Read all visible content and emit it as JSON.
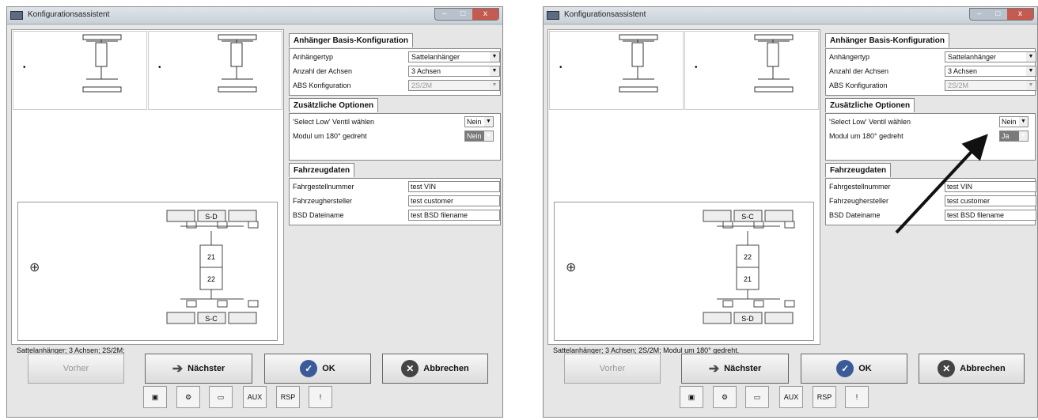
{
  "windows": [
    {
      "title": "Konfigurationsassistent",
      "groups": {
        "basis": {
          "title": "Anhänger Basis-Konfiguration",
          "rows": [
            {
              "label": "Anhängertyp",
              "value": "Sattelanhänger"
            },
            {
              "label": "Anzahl der Achsen",
              "value": "3 Achsen"
            },
            {
              "label": "ABS Konfiguration",
              "value": "2S/2M"
            }
          ]
        },
        "opts": {
          "title": "Zusätzliche Optionen",
          "rows": [
            {
              "label": "'Select Low' Ventil wählen",
              "value": "Nein"
            },
            {
              "label": "Modul um 180° gedreht",
              "value": "Nein"
            }
          ]
        },
        "fzg": {
          "title": "Fahrzeugdaten",
          "rows": [
            {
              "label": "Fahrgestellnummer",
              "value": "test VIN"
            },
            {
              "label": "Fahrzeughersteller",
              "value": "test customer"
            },
            {
              "label": "BSD Dateiname",
              "value": "test BSD filename"
            }
          ]
        }
      },
      "diagram": {
        "top_label": "S-D",
        "bottom_label": "S-C",
        "module_top": "21",
        "module_bottom": "22"
      },
      "status": "Sattelanhänger; 3 Achsen; 2S/2M;",
      "buttons": {
        "prev": "Vorher",
        "next": "Nächster",
        "ok": "OK",
        "cancel": "Abbrechen"
      },
      "toolbar": [
        "",
        "",
        "",
        "AUX",
        "RSP",
        "!"
      ]
    },
    {
      "title": "Konfigurationsassistent",
      "groups": {
        "basis": {
          "title": "Anhänger Basis-Konfiguration",
          "rows": [
            {
              "label": "Anhängertyp",
              "value": "Sattelanhänger"
            },
            {
              "label": "Anzahl der Achsen",
              "value": "3 Achsen"
            },
            {
              "label": "ABS Konfiguration",
              "value": "2S/2M"
            }
          ]
        },
        "opts": {
          "title": "Zusätzliche Optionen",
          "rows": [
            {
              "label": "'Select Low' Ventil wählen",
              "value": "Nein"
            },
            {
              "label": "Modul um 180° gedreht",
              "value": "Ja"
            }
          ]
        },
        "fzg": {
          "title": "Fahrzeugdaten",
          "rows": [
            {
              "label": "Fahrgestellnummer",
              "value": "test VIN"
            },
            {
              "label": "Fahrzeughersteller",
              "value": "test customer"
            },
            {
              "label": "BSD Dateiname",
              "value": "test BSD filename"
            }
          ]
        }
      },
      "diagram": {
        "top_label": "S-C",
        "bottom_label": "S-D",
        "module_top": "22",
        "module_bottom": "21"
      },
      "status": "Sattelanhänger; 3 Achsen; 2S/2M; Modul um 180° gedreht.",
      "buttons": {
        "prev": "Vorher",
        "next": "Nächster",
        "ok": "OK",
        "cancel": "Abbrechen"
      },
      "toolbar": [
        "",
        "",
        "",
        "AUX",
        "RSP",
        "!"
      ]
    }
  ],
  "colors": {
    "ok": "#3a5a9a",
    "cancel": "#444444",
    "next_arrow": "#4a4a4a"
  }
}
